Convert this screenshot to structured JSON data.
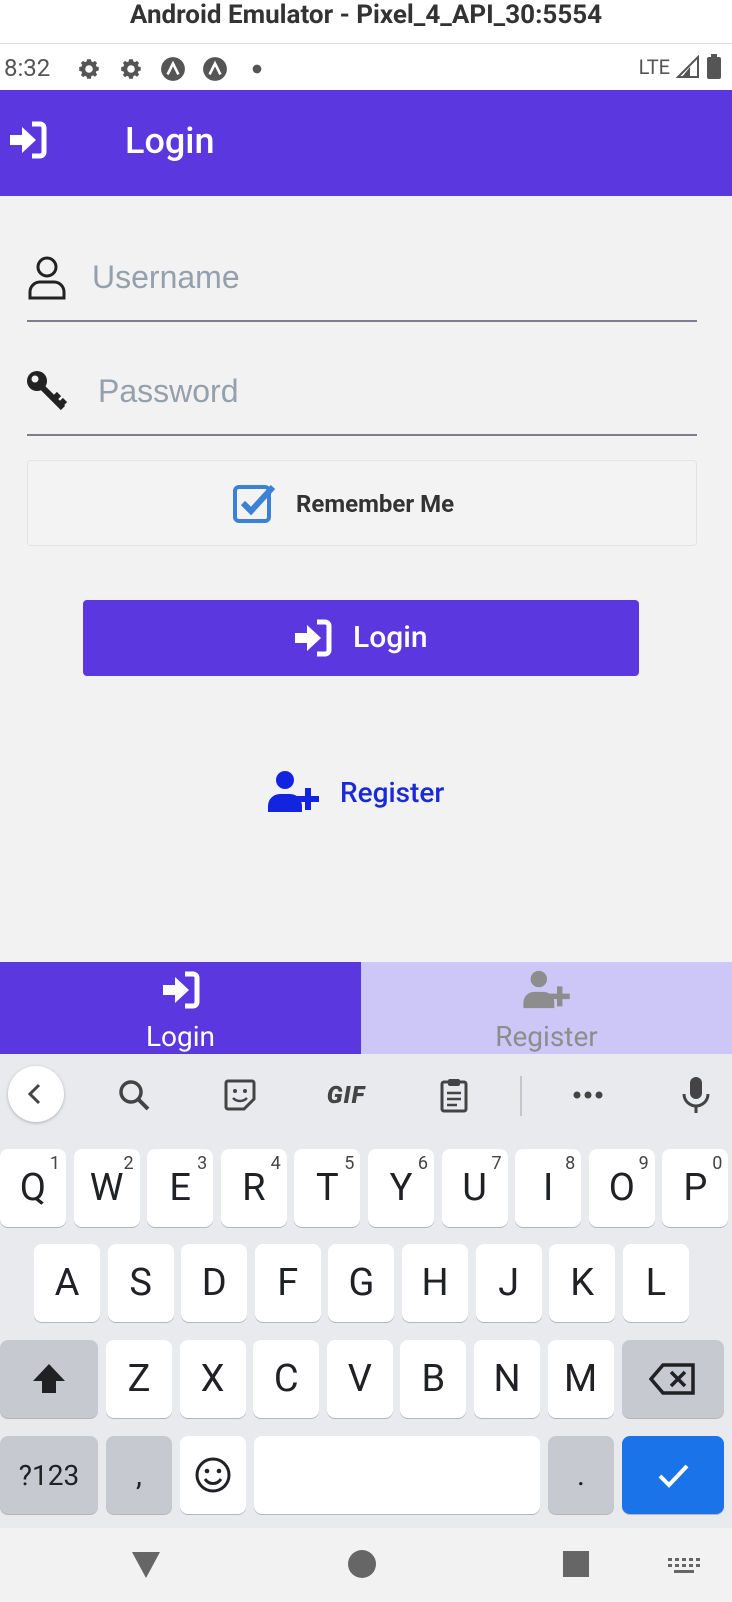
{
  "window_title": "Android Emulator - Pixel_4_API_30:5554",
  "status_bar": {
    "time": "8:32",
    "network": "LTE"
  },
  "app_bar": {
    "title": "Login"
  },
  "form": {
    "username_placeholder": "Username",
    "password_placeholder": "Password",
    "remember_label": "Remember Me",
    "remember_checked": true,
    "login_button": "Login",
    "register_link": "Register"
  },
  "tabs": [
    {
      "label": "Login",
      "active": true
    },
    {
      "label": "Register",
      "active": false
    }
  ],
  "keyboard": {
    "row1": [
      {
        "k": "Q",
        "n": "1"
      },
      {
        "k": "W",
        "n": "2"
      },
      {
        "k": "E",
        "n": "3"
      },
      {
        "k": "R",
        "n": "4"
      },
      {
        "k": "T",
        "n": "5"
      },
      {
        "k": "Y",
        "n": "6"
      },
      {
        "k": "U",
        "n": "7"
      },
      {
        "k": "I",
        "n": "8"
      },
      {
        "k": "O",
        "n": "9"
      },
      {
        "k": "P",
        "n": "0"
      }
    ],
    "row2": [
      "A",
      "S",
      "D",
      "F",
      "G",
      "H",
      "J",
      "K",
      "L"
    ],
    "row3": [
      "Z",
      "X",
      "C",
      "V",
      "B",
      "N",
      "M"
    ],
    "symbols_key": "?123",
    "comma_key": ",",
    "period_key": ".",
    "gif_label": "GIF"
  },
  "colors": {
    "primary": "#5b37e0",
    "tab_inactive": "#cdc7f7",
    "link": "#1a2bd6",
    "keyboard_action": "#1a73e8"
  }
}
